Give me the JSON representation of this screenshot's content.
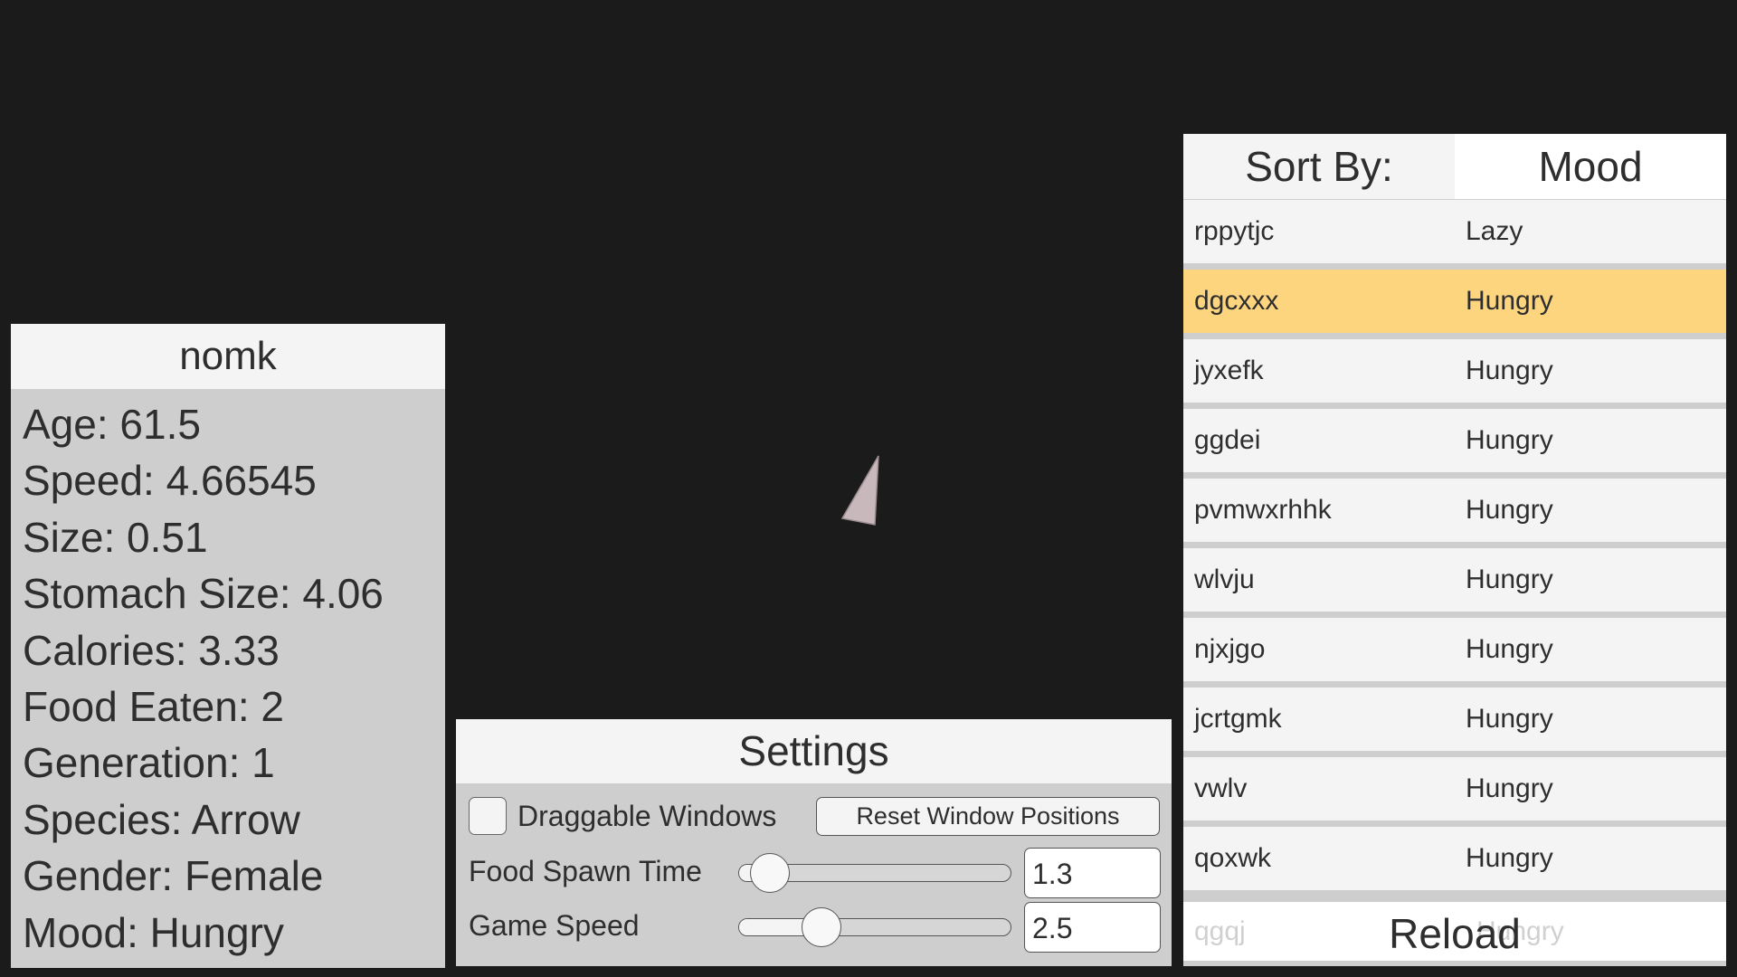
{
  "creature": {
    "name": "nomk",
    "stats": [
      "Age: 61.5",
      "Speed: 4.66545",
      "Size: 0.51",
      "Stomach Size: 4.06",
      "Calories: 3.33",
      "Food Eaten: 2",
      "Generation: 1",
      "Species: Arrow",
      "Gender: Female",
      "Mood: Hungry"
    ]
  },
  "settings": {
    "title": "Settings",
    "draggable_label": "Draggable Windows",
    "draggable_checked": false,
    "reset_label": "Reset Window Positions",
    "food_spawn": {
      "label": "Food Spawn Time",
      "value": "1.3",
      "slider_fraction": 0.05
    },
    "game_speed": {
      "label": "Game Speed",
      "value": "2.5",
      "slider_fraction": 0.27
    }
  },
  "list": {
    "sort_label": "Sort By:",
    "sort_value": "Mood",
    "reload_label": "Reload",
    "selected_index": 1,
    "rows": [
      [
        "rppytjc",
        "Lazy"
      ],
      [
        "dgcxxx",
        "Hungry"
      ],
      [
        "jyxefk",
        "Hungry"
      ],
      [
        "ggdei",
        "Hungry"
      ],
      [
        "pvmwxrhhk",
        "Hungry"
      ],
      [
        "wlvju",
        "Hungry"
      ],
      [
        "njxjgo",
        "Hungry"
      ],
      [
        "jcrtgmk",
        "Hungry"
      ],
      [
        "vwlv",
        "Hungry"
      ],
      [
        "qoxwk",
        "Hungry"
      ]
    ],
    "partial_row": [
      "qgqj",
      "Hungry"
    ]
  },
  "colors": {
    "creature": "#c8b8bc",
    "selected": "#fdd57f"
  }
}
